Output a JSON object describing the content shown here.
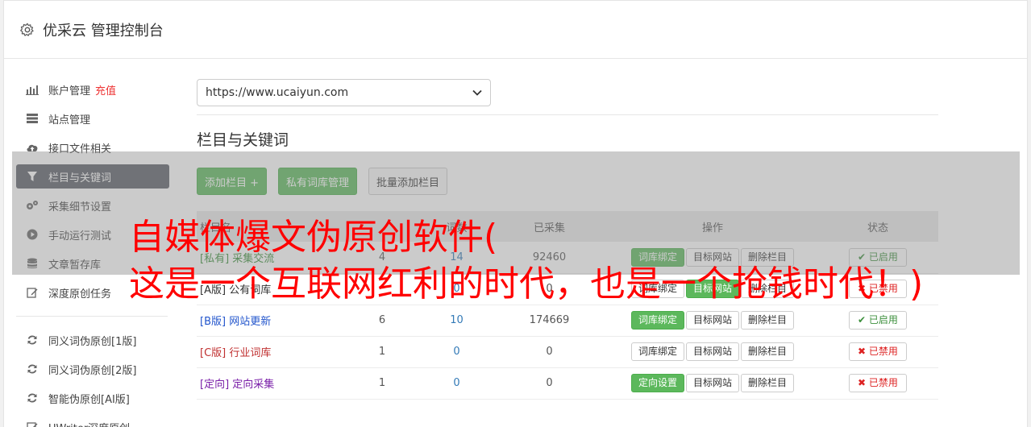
{
  "header": {
    "title": "优采云 管理控制台",
    "icon": "gear-icon"
  },
  "sidebar": {
    "items": [
      {
        "label": "账户管理",
        "extra": "充值",
        "icon": "bar-chart-icon"
      },
      {
        "label": "站点管理",
        "icon": "server-icon"
      },
      {
        "label": "接口文件相关",
        "icon": "cloud-upload-icon"
      },
      {
        "label": "栏目与关键词",
        "icon": "filter-icon",
        "active": true
      },
      {
        "label": "采集细节设置",
        "icon": "cogs-icon"
      },
      {
        "label": "手动运行测试",
        "icon": "play-circle-icon"
      },
      {
        "label": "文章暂存库",
        "icon": "database-icon"
      },
      {
        "label": "深度原创任务",
        "icon": "edit-icon"
      },
      {
        "label": "同义词伪原创[1版]",
        "icon": "refresh-icon"
      },
      {
        "label": "同义词伪原创[2版]",
        "icon": "refresh-icon"
      },
      {
        "label": "智能伪原创[AI版]",
        "icon": "refresh-icon"
      },
      {
        "label": "UWriter深度原创",
        "icon": "edit-icon"
      }
    ]
  },
  "main": {
    "site_select": "https://www.ucaiyun.com",
    "section_title": "栏目与关键词",
    "buttons": {
      "add": "添加栏目 +",
      "private": "私有词库管理",
      "batch": "批量添加栏目"
    },
    "table": {
      "headers": [
        "栏目名",
        "",
        "词数",
        "已采集",
        "操作",
        "状态"
      ],
      "rows": [
        {
          "tag": "[私有]",
          "name": "采集交流",
          "a": "4",
          "b": "14",
          "collected": "92460",
          "op1": "词库绑定",
          "op1_green": true,
          "op2": "目标网站",
          "op3": "删除栏目",
          "status": "已启用",
          "on": true,
          "cls": "tag-private"
        },
        {
          "tag": "[A版]",
          "name": "公有词库",
          "a": "",
          "b": "0",
          "collected": "0",
          "op1": "词库绑定",
          "op1_green": false,
          "op2": "目标网站",
          "op2_green": true,
          "op3": "删除栏目",
          "status": "已禁用",
          "on": false,
          "cls": "tag-a"
        },
        {
          "tag": "[B版]",
          "name": "网站更新",
          "a": "6",
          "b": "10",
          "collected": "174669",
          "op1": "词库绑定",
          "op1_green": true,
          "op2": "目标网站",
          "op3": "删除栏目",
          "status": "已启用",
          "on": true,
          "cls": "tag-b"
        },
        {
          "tag": "[C版]",
          "name": "行业词库",
          "a": "1",
          "b": "0",
          "collected": "0",
          "op1": "词库绑定",
          "op1_green": false,
          "op2": "目标网站",
          "op3": "删除栏目",
          "status": "已禁用",
          "on": false,
          "cls": "tag-c"
        },
        {
          "tag": "[定向]",
          "name": "定向采集",
          "a": "1",
          "b": "0",
          "collected": "0",
          "op1": "定向设置",
          "op1_green": true,
          "op2": "目标网站",
          "op3": "删除栏目",
          "status": "已禁用",
          "on": false,
          "cls": "tag-d"
        }
      ]
    }
  },
  "watermark": {
    "line1": "自媒体爆文伪原创软件(",
    "line2": "这是一个互联网红利的时代，也是一个抢钱时代！)"
  }
}
